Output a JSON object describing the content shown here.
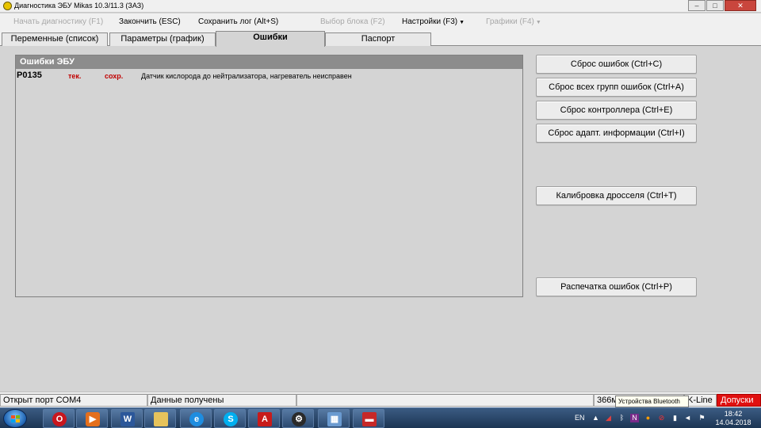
{
  "window": {
    "title": "Диагностика ЭБУ Mikas 10.3/11.3 (ЗАЗ)",
    "minimize_icon": "minimize-icon",
    "maximize_icon": "maximize-icon",
    "close_icon": "close-icon"
  },
  "menu": {
    "start_diag": "Начать диагностику (F1)",
    "finish": "Закончить (ESC)",
    "save_log": "Сохранить лог (Alt+S)",
    "select_block": "Выбор блока (F2)",
    "settings": "Настройки (F3)",
    "graphs": "Графики (F4)"
  },
  "tabs": [
    {
      "label": "Переменные (список)"
    },
    {
      "label": "Параметры (график)"
    },
    {
      "label": "Ошибки"
    },
    {
      "label": "Паспорт"
    }
  ],
  "errors_panel": {
    "header": "Ошибки ЭБУ",
    "rows": [
      {
        "code": "P0135",
        "current": "тек.",
        "saved": "сохр.",
        "description": "Датчик кислорода до нейтрализатора, нагреватель неисправен"
      }
    ]
  },
  "buttons": {
    "reset_errors": "Сброс ошибок (Ctrl+C)",
    "reset_all_groups": "Сброс всех групп ошибок (Ctrl+A)",
    "reset_controller": "Сброс контроллера (Ctrl+E)",
    "reset_adapt": "Сброс адапт. информации (Ctrl+I)",
    "throttle_calib": "Калибровка дросселя (Ctrl+T)",
    "print_errors": "Распечатка ошибок (Ctrl+P)"
  },
  "statusbar": {
    "port": "Открыт порт COM4",
    "data": "Данные получены",
    "empty": "",
    "speed": "366м",
    "kline": "K-Line",
    "tolerances": "Допуски"
  },
  "tooltip": "Устройства Bluetooth",
  "taskbar": {
    "lang": "EN",
    "time": "18:42",
    "date": "14.04.2018",
    "apps": [
      "opera-icon",
      "media-player-icon",
      "word-icon",
      "file-explorer-icon",
      "internet-explorer-icon",
      "skype-icon",
      "acrobat-icon",
      "diagnostic-app-icon",
      "control-panel-icon",
      "toolbox-icon"
    ]
  },
  "colors": {
    "error_flag": "#c00000",
    "panel_header": "#8c8c8c",
    "tolerances_bg": "#e01010"
  }
}
